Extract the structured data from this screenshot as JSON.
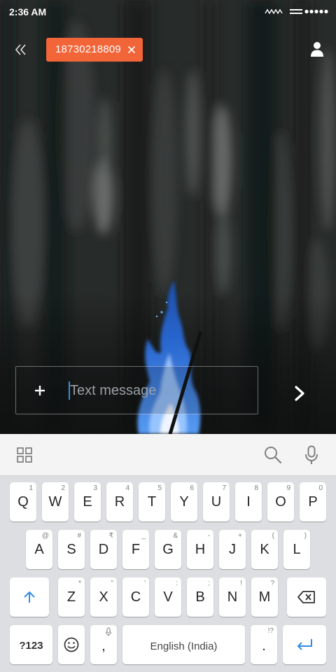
{
  "status_bar": {
    "time": "2:36 AM",
    "icons": [
      "wave-icon",
      "network-icon",
      "signal-dots-icon"
    ]
  },
  "header": {
    "recipient": "18730218809",
    "icons": [
      "double-chevron-left-icon",
      "close-icon",
      "person-icon"
    ]
  },
  "composer": {
    "placeholder": "Text message",
    "icons": [
      "plus-icon",
      "chevron-right-icon"
    ]
  },
  "keyboard_toolbar": {
    "icons": [
      "grid-icon",
      "search-icon",
      "mic-icon"
    ]
  },
  "keyboard": {
    "row1": [
      {
        "label": "Q",
        "hint": "1"
      },
      {
        "label": "W",
        "hint": "2"
      },
      {
        "label": "E",
        "hint": "3"
      },
      {
        "label": "R",
        "hint": "4"
      },
      {
        "label": "T",
        "hint": "5"
      },
      {
        "label": "Y",
        "hint": "6"
      },
      {
        "label": "U",
        "hint": "7"
      },
      {
        "label": "I",
        "hint": "8"
      },
      {
        "label": "O",
        "hint": "9"
      },
      {
        "label": "P",
        "hint": "0"
      }
    ],
    "row2": [
      {
        "label": "A",
        "hint": "@"
      },
      {
        "label": "S",
        "hint": "#"
      },
      {
        "label": "D",
        "hint": "₹"
      },
      {
        "label": "F",
        "hint": "_"
      },
      {
        "label": "G",
        "hint": "&"
      },
      {
        "label": "H",
        "hint": "-"
      },
      {
        "label": "J",
        "hint": "+"
      },
      {
        "label": "K",
        "hint": "("
      },
      {
        "label": "L",
        "hint": ")"
      }
    ],
    "row3": [
      {
        "label": "Z",
        "hint": "*"
      },
      {
        "label": "X",
        "hint": "\""
      },
      {
        "label": "C",
        "hint": "'"
      },
      {
        "label": "V",
        "hint": ":"
      },
      {
        "label": "B",
        "hint": ";"
      },
      {
        "label": "N",
        "hint": "!"
      },
      {
        "label": "M",
        "hint": "?"
      }
    ],
    "row4": {
      "symbols": "?123",
      "comma": ",",
      "space": "English (India)",
      "period": ".",
      "period_hint": "!?"
    },
    "icons": [
      "shift-icon",
      "backspace-icon",
      "emoji-icon",
      "enter-icon"
    ]
  },
  "colors": {
    "chip": "#f26539",
    "accent": "#2f8de4",
    "keyboard_bg": "#dcdee1"
  }
}
